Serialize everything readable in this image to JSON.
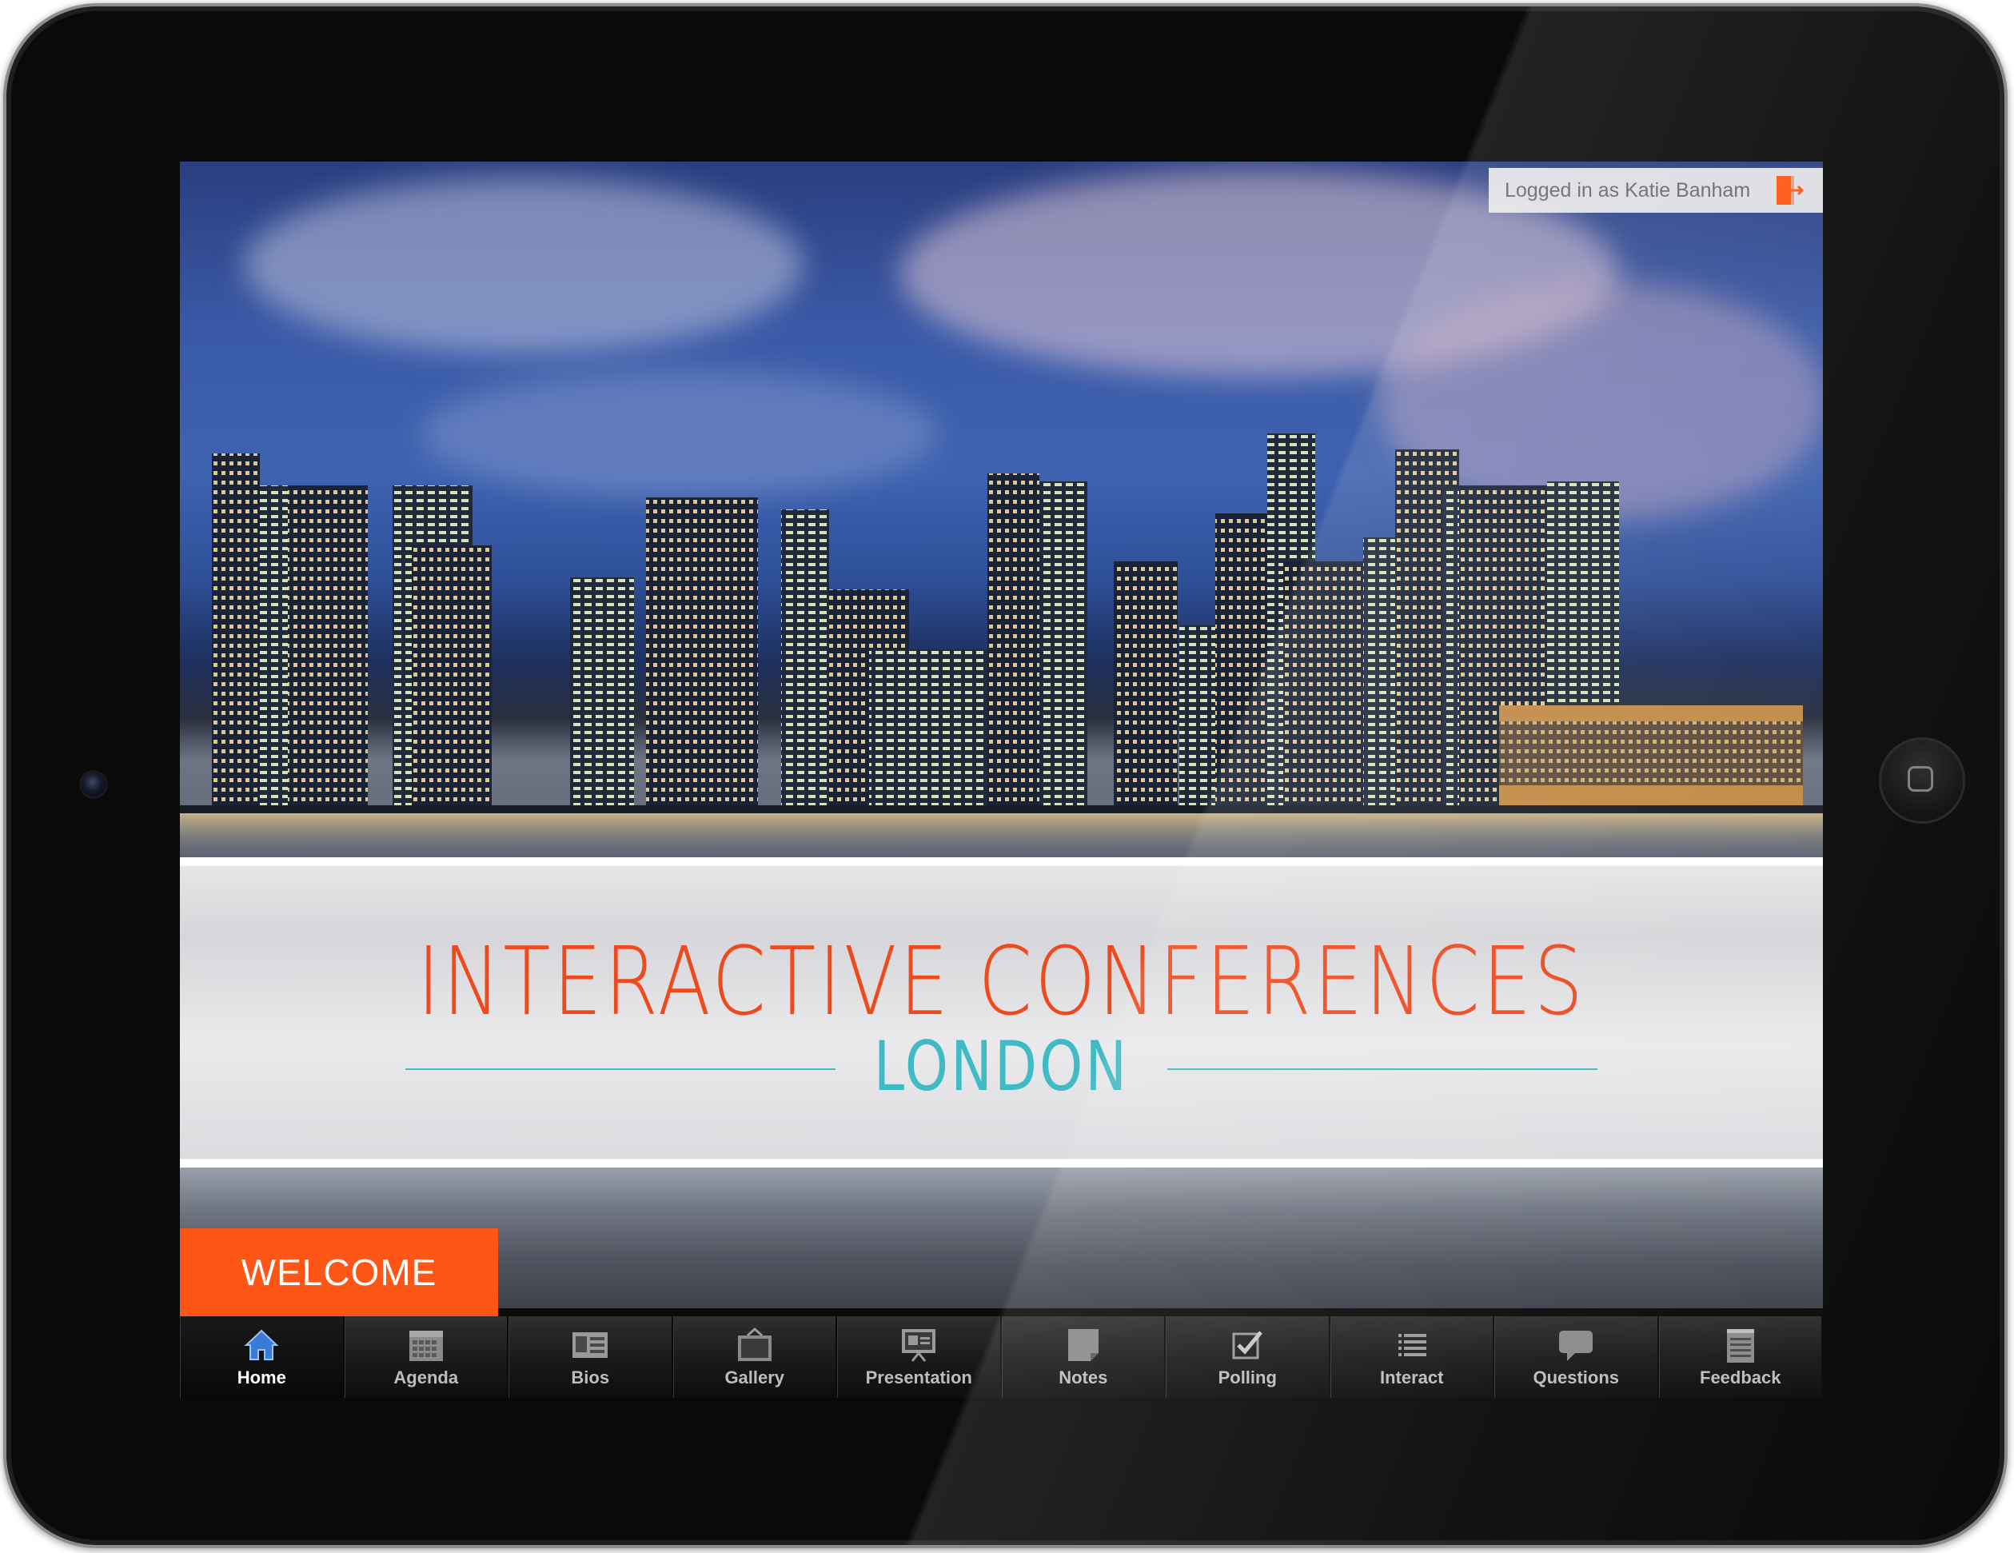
{
  "header": {
    "login_text": "Logged in as Katie Banham"
  },
  "banner": {
    "title": "INTERACTIVE CONFERENCES",
    "subtitle": "LONDON"
  },
  "welcome_label": "WELCOME",
  "tabs": [
    {
      "label": "Home",
      "icon": "home-icon",
      "active": true
    },
    {
      "label": "Agenda",
      "icon": "calendar-icon"
    },
    {
      "label": "Bios",
      "icon": "id-card-icon"
    },
    {
      "label": "Gallery",
      "icon": "gallery-icon"
    },
    {
      "label": "Presentation",
      "icon": "presentation-icon"
    },
    {
      "label": "Notes",
      "icon": "notes-icon"
    },
    {
      "label": "Polling",
      "icon": "checkbox-icon"
    },
    {
      "label": "Interact",
      "icon": "list-icon"
    },
    {
      "label": "Questions",
      "icon": "speech-bubble-icon"
    },
    {
      "label": "Feedback",
      "icon": "notepad-icon"
    }
  ],
  "colors": {
    "accent": "#fe5616",
    "title": "#ee4a1e",
    "subtitle": "#40bac4",
    "home_icon": "#3a7bd5"
  }
}
